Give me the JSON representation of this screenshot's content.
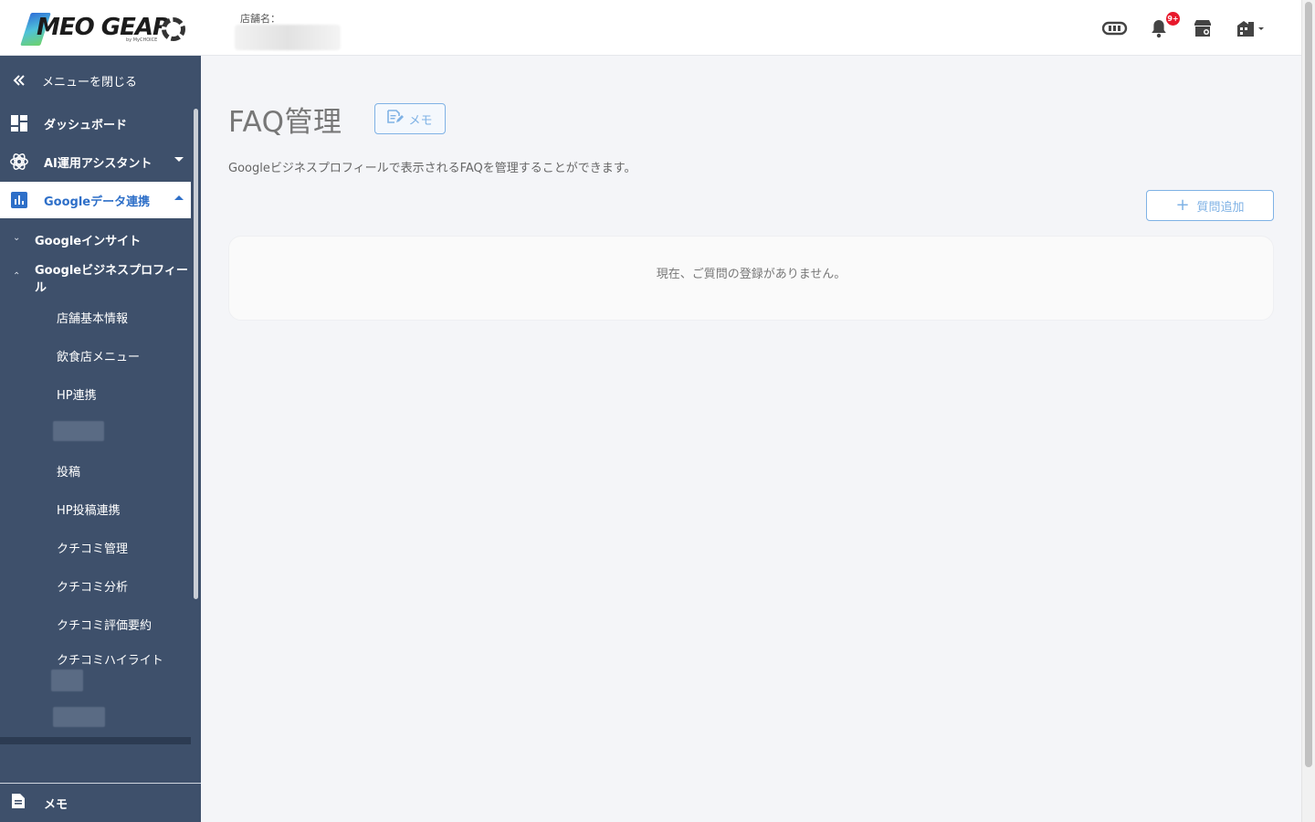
{
  "header": {
    "logo_text": "MEO GEAR",
    "logo_sub": "by MyCHOICE",
    "store_label": "店舗名：",
    "notification_count": "9+"
  },
  "sidebar": {
    "close_menu": "メニューを閉じる",
    "items": [
      {
        "label": "ダッシュボード",
        "icon": "dashboard-icon"
      },
      {
        "label": "AI運用アシスタント",
        "icon": "openai-icon"
      },
      {
        "label": "Googleデータ連携",
        "icon": "bar-chart-icon"
      }
    ],
    "groups": [
      {
        "label": "Googleインサイト",
        "chevron": "⌄"
      },
      {
        "label": "Googleビジネスプロフィール",
        "chevron": "⌃"
      }
    ],
    "leaves": [
      "店舗基本情報",
      "飲食店メニュー",
      "HP連携",
      "投稿",
      "HP投稿連携",
      "クチコミ管理",
      "クチコミ分析",
      "クチコミ評価要約",
      "クチコミハイライト"
    ],
    "memo": "メモ"
  },
  "main": {
    "title": "FAQ管理",
    "memo_button": "メモ",
    "description": "Googleビジネスプロフィールで表示されるFAQを管理することができます。",
    "add_button": "質問追加",
    "empty_message": "現在、ご質問の登録がありません。"
  },
  "colors": {
    "sidebar_bg": "#3e506b",
    "accent": "#2e6fc8",
    "button_border": "#7fb2e5",
    "badge": "#e8192c"
  }
}
